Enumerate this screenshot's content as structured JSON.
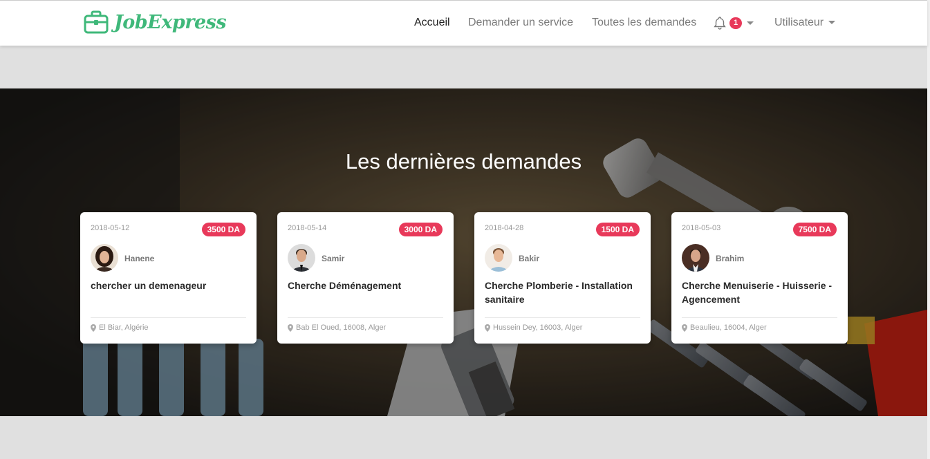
{
  "brand": {
    "name": "JobExpress"
  },
  "nav": {
    "home": "Accueil",
    "request_service": "Demander un service",
    "all_requests": "Toutes les demandes",
    "notification_count": "1",
    "user": "Utilisateur"
  },
  "hero": {
    "title": "Les dernières demandes"
  },
  "cards": [
    {
      "date": "2018-05-12",
      "price": "3500 DA",
      "user": "Hanene",
      "title": "chercher un demenageur",
      "location": "El Biar, Algérie"
    },
    {
      "date": "2018-05-14",
      "price": "3000 DA",
      "user": "Samir",
      "title": "Cherche Déménagement",
      "location": "Bab El Oued, 16008, Alger"
    },
    {
      "date": "2018-04-28",
      "price": "1500 DA",
      "user": "Bakir",
      "title": "Cherche Plomberie - Installation sanitaire",
      "location": "Hussein Dey, 16003, Alger"
    },
    {
      "date": "2018-05-03",
      "price": "7500 DA",
      "user": "Brahim",
      "title": "Cherche Menuiserie - Huisserie - Agencement",
      "location": "Beaulieu, 16004, Alger"
    }
  ],
  "colors": {
    "brand_green": "#3fb87a",
    "accent_red": "#e8395a"
  },
  "icons": {
    "logo": "briefcase-icon",
    "notifications": "bell-icon",
    "location": "map-pin-icon"
  }
}
